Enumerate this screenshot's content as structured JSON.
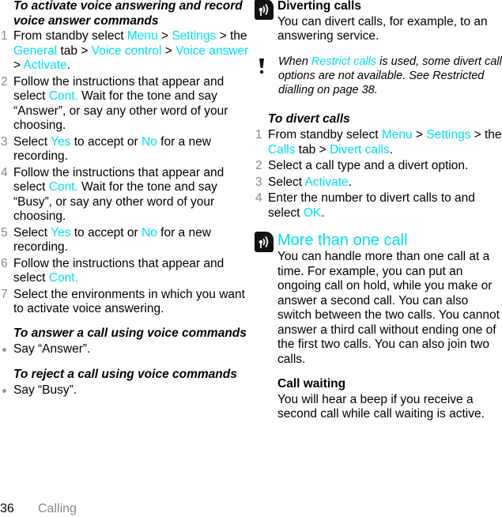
{
  "left": {
    "activate_heading": "To activate voice answering and record voice answer commands",
    "steps": [
      {
        "num": "1",
        "parts": [
          {
            "t": "From standby select "
          },
          {
            "t": "Menu",
            "hl": true
          },
          {
            "t": " > "
          },
          {
            "t": "Settings",
            "hl": true
          },
          {
            "t": " > the "
          },
          {
            "t": "General",
            "hl": true
          },
          {
            "t": " tab > "
          },
          {
            "t": "Voice control",
            "hl": true
          },
          {
            "t": " > "
          },
          {
            "t": "Voice answer",
            "hl": true
          },
          {
            "t": " > "
          },
          {
            "t": "Activate",
            "hl": true
          },
          {
            "t": "."
          }
        ]
      },
      {
        "num": "2",
        "parts": [
          {
            "t": "Follow the instructions that appear and select "
          },
          {
            "t": "Cont.",
            "hl": true
          },
          {
            "t": " Wait for the tone and say “Answer”, or say any other word of your choosing."
          }
        ]
      },
      {
        "num": "3",
        "parts": [
          {
            "t": "Select "
          },
          {
            "t": "Yes",
            "hl": true
          },
          {
            "t": " to accept or "
          },
          {
            "t": "No",
            "hl": true
          },
          {
            "t": " for a new recording."
          }
        ]
      },
      {
        "num": "4",
        "parts": [
          {
            "t": "Follow the instructions that appear and select "
          },
          {
            "t": "Cont.",
            "hl": true
          },
          {
            "t": " Wait for the tone and say “Busy”, or say any other word of your choosing."
          }
        ]
      },
      {
        "num": "5",
        "parts": [
          {
            "t": "Select "
          },
          {
            "t": "Yes",
            "hl": true
          },
          {
            "t": " to accept or "
          },
          {
            "t": "No",
            "hl": true
          },
          {
            "t": " for a new recording."
          }
        ]
      },
      {
        "num": "6",
        "parts": [
          {
            "t": "Follow the instructions that appear and select "
          },
          {
            "t": "Cont.",
            "hl": true
          }
        ]
      },
      {
        "num": "7",
        "parts": [
          {
            "t": "Select the environments in which you want to activate voice answering."
          }
        ]
      }
    ],
    "answer_heading": "To answer a call using voice commands",
    "answer_bullet": "Say “Answer”.",
    "reject_heading": "To reject a call using voice commands",
    "reject_bullet": "Say “Busy”."
  },
  "right": {
    "diverting_title": "Diverting calls",
    "diverting_body": "You can divert calls, for example, to an answering service.",
    "note_parts": [
      {
        "t": "When "
      },
      {
        "t": "Restrict calls",
        "hl": true
      },
      {
        "t": " is used, some divert call options are not available. See Restricted dialling on page 38."
      }
    ],
    "divert_heading": "To divert calls",
    "divert_steps": [
      {
        "num": "1",
        "parts": [
          {
            "t": "From standby select "
          },
          {
            "t": "Menu",
            "hl": true
          },
          {
            "t": " > "
          },
          {
            "t": "Settings",
            "hl": true
          },
          {
            "t": " > the "
          },
          {
            "t": "Calls",
            "hl": true
          },
          {
            "t": " tab > "
          },
          {
            "t": "Divert calls",
            "hl": true
          },
          {
            "t": "."
          }
        ]
      },
      {
        "num": "2",
        "parts": [
          {
            "t": "Select a call type and a divert option."
          }
        ]
      },
      {
        "num": "3",
        "parts": [
          {
            "t": "Select "
          },
          {
            "t": "Activate",
            "hl": true
          },
          {
            "t": "."
          }
        ]
      },
      {
        "num": "4",
        "parts": [
          {
            "t": "Enter the number to divert calls to and select "
          },
          {
            "t": "OK",
            "hl": true
          },
          {
            "t": "."
          }
        ]
      }
    ],
    "more_title": "More than one call",
    "more_body": "You can handle more than one call at a time. For example, you can put an ongoing call on hold, while you make or answer a second call. You can also switch between the two calls. You cannot answer a third call without ending one of the first two calls. You can also join two calls.",
    "waiting_title": "Call waiting",
    "waiting_body": "You will hear a beep if you receive a second call while call waiting is active."
  },
  "footer": {
    "page_number": "36",
    "section": "Calling"
  },
  "colors": {
    "highlight": "#00e0f0",
    "step_number": "#888888",
    "footer_section": "#888888"
  },
  "icons": {
    "network_service": "network-service-icon",
    "note": "exclamation-icon"
  }
}
